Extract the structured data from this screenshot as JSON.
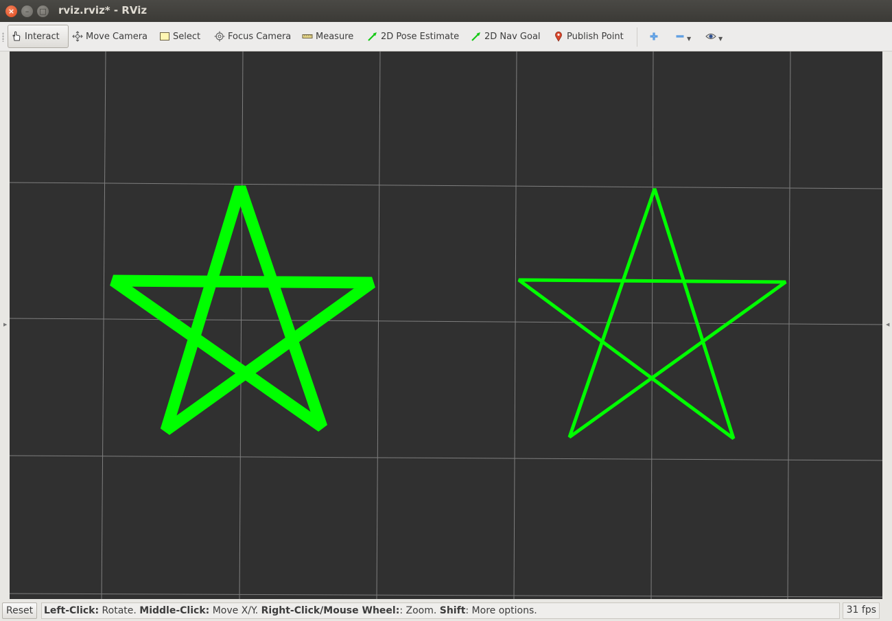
{
  "window": {
    "title": "rviz.rviz* - RViz",
    "close_glyph": "×",
    "min_glyph": "–",
    "max_glyph": "□"
  },
  "toolbar": {
    "tools": [
      {
        "label": "Interact",
        "icon": "hand-pointer-icon",
        "active": true
      },
      {
        "label": "Move Camera",
        "icon": "move-camera-icon",
        "active": false
      },
      {
        "label": "Select",
        "icon": "select-box-icon",
        "active": false
      },
      {
        "label": "Focus Camera",
        "icon": "focus-target-icon",
        "active": false
      },
      {
        "label": "Measure",
        "icon": "ruler-icon",
        "active": false
      },
      {
        "label": "2D Pose Estimate",
        "icon": "green-arrow-icon",
        "active": false
      },
      {
        "label": "2D Nav Goal",
        "icon": "green-arrow-icon",
        "active": false
      },
      {
        "label": "Publish Point",
        "icon": "map-pin-icon",
        "active": false
      }
    ],
    "add_tool_icon": "plus-icon",
    "remove_tool_icon": "minus-icon",
    "view_icon": "eye-icon",
    "caret_glyph": "▼"
  },
  "viewport": {
    "background_color": "#303030",
    "grid_color": "#9a9a9a",
    "marker_color": "#00ff00",
    "collapse_left_glyph": "▶",
    "collapse_right_glyph": "◀"
  },
  "status": {
    "reset_label": "Reset",
    "hint_parts": [
      {
        "text": "Left-Click:",
        "bold": true
      },
      {
        "text": " Rotate. ",
        "bold": false
      },
      {
        "text": "Middle-Click:",
        "bold": true
      },
      {
        "text": " Move X/Y. ",
        "bold": false
      },
      {
        "text": "Right-Click/Mouse Wheel:",
        "bold": true
      },
      {
        "text": ": Zoom. ",
        "bold": false
      },
      {
        "text": "Shift",
        "bold": true
      },
      {
        "text": ": More options.",
        "bold": false
      }
    ],
    "fps": "31 fps"
  }
}
